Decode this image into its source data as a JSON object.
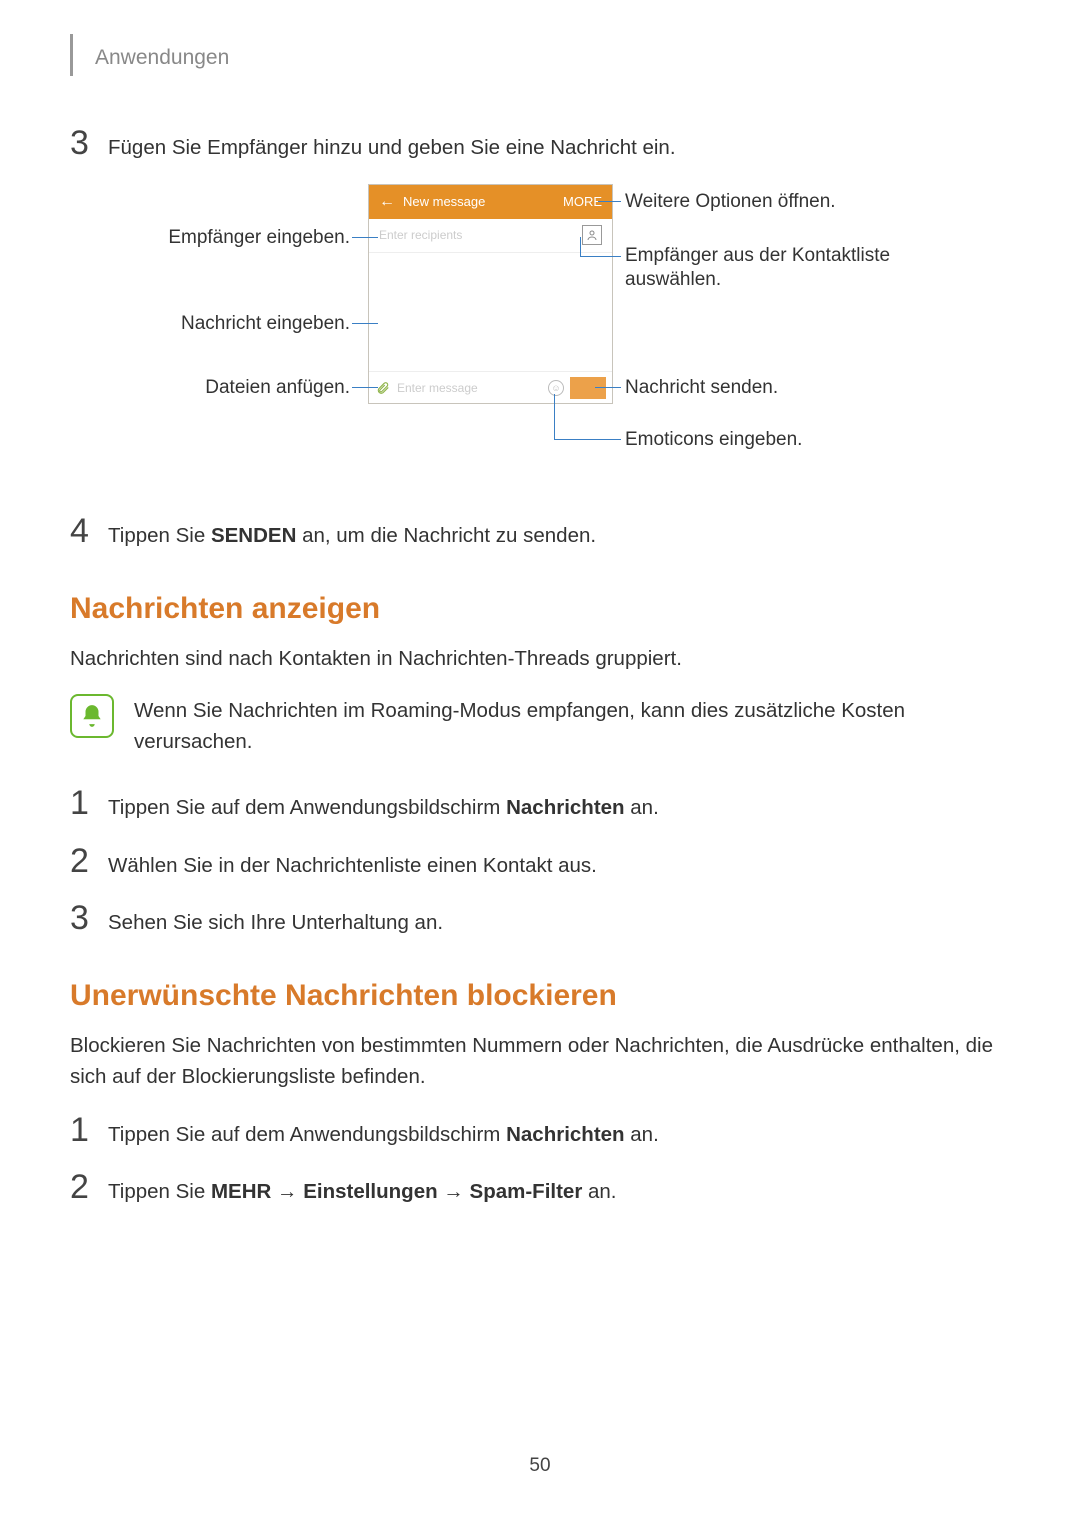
{
  "header": "Anwendungen",
  "step3": {
    "num": "3",
    "text": "Fügen Sie Empfänger hinzu und geben Sie eine Nachricht ein."
  },
  "step4": {
    "num": "4",
    "prefix": "Tippen Sie ",
    "bold": "SENDEN",
    "suffix": " an, um die Nachricht zu senden."
  },
  "diagram": {
    "phone": {
      "title": "New message",
      "more": "MORE",
      "recipient_placeholder": "Enter recipients",
      "message_placeholder": "Enter message"
    },
    "labels": {
      "left1": "Empfänger eingeben.",
      "left2": "Nachricht eingeben.",
      "left3": "Dateien anfügen.",
      "right1": "Weitere Optionen öffnen.",
      "right2": "Empfänger aus der Kontaktliste auswählen.",
      "right3": "Nachricht senden.",
      "right4": "Emoticons eingeben."
    }
  },
  "section1": {
    "title": "Nachrichten anzeigen",
    "intro": "Nachrichten sind nach Kontakten in Nachrichten-Threads gruppiert.",
    "note": "Wenn Sie Nachrichten im Roaming-Modus empfangen, kann dies zusätzliche Kosten verursachen.",
    "steps": [
      {
        "num": "1",
        "prefix": "Tippen Sie auf dem Anwendungsbildschirm ",
        "bold": "Nachrichten",
        "suffix": " an."
      },
      {
        "num": "2",
        "text": "Wählen Sie in der Nachrichtenliste einen Kontakt aus."
      },
      {
        "num": "3",
        "text": "Sehen Sie sich Ihre Unterhaltung an."
      }
    ]
  },
  "section2": {
    "title": "Unerwünschte Nachrichten blockieren",
    "intro": "Blockieren Sie Nachrichten von bestimmten Nummern oder Nachrichten, die Ausdrücke enthalten, die sich auf der Blockierungsliste befinden.",
    "steps": [
      {
        "num": "1",
        "prefix": "Tippen Sie auf dem Anwendungsbildschirm ",
        "bold": "Nachrichten",
        "suffix": " an."
      },
      {
        "num": "2",
        "prefix": "Tippen Sie ",
        "b1": "MEHR",
        "arrow1": " → ",
        "b2": "Einstellungen",
        "arrow2": " → ",
        "b3": "Spam-Filter",
        "suffix": " an."
      }
    ]
  },
  "pageNumber": "50"
}
